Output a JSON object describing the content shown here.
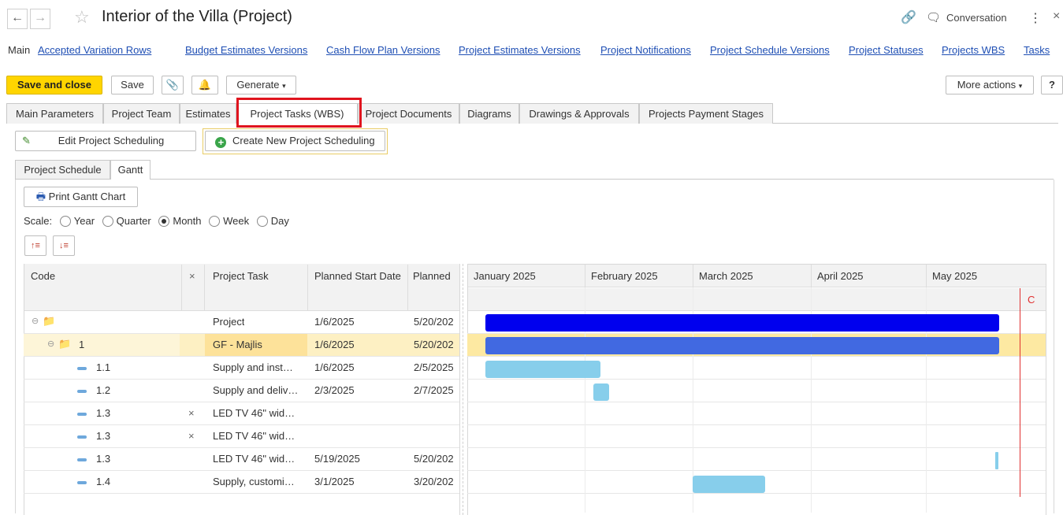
{
  "window": {
    "title": "Interior of the Villa (Project)",
    "conversation_label": "Conversation",
    "more_icon": "⋮",
    "close_icon": "×"
  },
  "nav": {
    "main": "Main",
    "links": [
      "Accepted Variation Rows",
      "Budget Estimates Versions",
      "Cash Flow Plan Versions",
      "Project Estimates Versions",
      "Project Notifications",
      "Project Schedule Versions",
      "Project Statuses",
      "Projects WBS",
      "Tasks"
    ]
  },
  "toolbar": {
    "save_close": "Save and close",
    "save": "Save",
    "generate": "Generate",
    "more_actions": "More actions",
    "help": "?"
  },
  "tabs": [
    "Main Parameters",
    "Project Team",
    "Estimates",
    "Project Tasks (WBS)",
    "Project Documents",
    "Diagrams",
    "Drawings & Approvals",
    "Projects Payment Stages"
  ],
  "scheduling": {
    "edit": "Edit Project Scheduling",
    "create": "Create New Project Scheduling"
  },
  "subtabs": [
    "Project Schedule",
    "Gantt"
  ],
  "gantt": {
    "print": "Print Gantt Chart",
    "scale_label": "Scale:",
    "scales": [
      "Year",
      "Quarter",
      "Month",
      "Week",
      "Day"
    ],
    "selected_scale": "Month",
    "columns": {
      "code": "Code",
      "x": "×",
      "task": "Project Task",
      "start": "Planned Start Date",
      "end": "Planned"
    },
    "months": [
      "January 2025",
      "February 2025",
      "March 2025",
      "April 2025",
      "May 2025"
    ],
    "current_marker": "C",
    "rows": [
      {
        "code": "",
        "x": "",
        "task": "Project",
        "start": "1/6/2025",
        "end": "5/20/202"
      },
      {
        "code": "1",
        "x": "",
        "task": "GF - Majlis",
        "start": "1/6/2025",
        "end": "5/20/202"
      },
      {
        "code": "1.1",
        "x": "",
        "task": "Supply and inst…",
        "start": "1/6/2025",
        "end": "2/5/2025"
      },
      {
        "code": "1.2",
        "x": "",
        "task": "Supply and deliv…",
        "start": "2/3/2025",
        "end": "2/7/2025"
      },
      {
        "code": "1.3",
        "x": "×",
        "task": "LED TV 46\" wid…",
        "start": "",
        "end": ""
      },
      {
        "code": "1.3",
        "x": "×",
        "task": "LED TV 46\" wid…",
        "start": "",
        "end": ""
      },
      {
        "code": "1.3",
        "x": "",
        "task": "LED TV 46\" wid…",
        "start": "5/19/2025",
        "end": "5/20/202"
      },
      {
        "code": "1.4",
        "x": "",
        "task": "Supply, customi…",
        "start": "3/1/2025",
        "end": "3/20/202"
      }
    ],
    "colors": {
      "project": "#0000ee",
      "group": "#4169e1",
      "task": "#87ceeb",
      "today": "#e03030",
      "selected_row": "#fdf0c3"
    }
  }
}
